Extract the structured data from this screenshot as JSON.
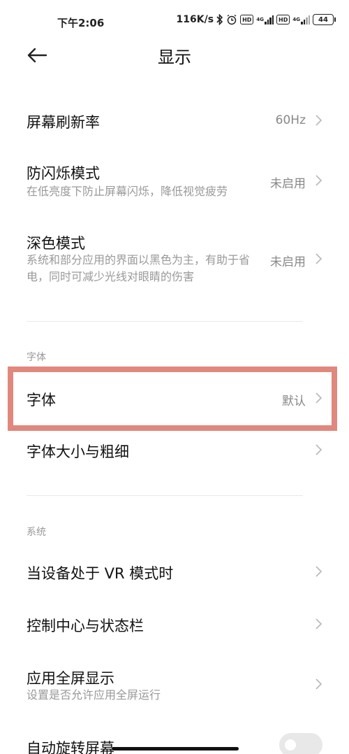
{
  "status_bar": {
    "time": "下午2:06",
    "speed": "116K/s",
    "hd1": "HD",
    "net1": "4G",
    "hd2": "HD",
    "net2": "4G",
    "battery": "44"
  },
  "header": {
    "title": "显示"
  },
  "rows": {
    "refresh": {
      "title": "屏幕刷新率",
      "value": "60Hz"
    },
    "flicker": {
      "title": "防闪烁模式",
      "sub": "在低亮度下防止屏幕闪烁，降低视觉疲劳",
      "value": "未启用"
    },
    "dark": {
      "title": "深色模式",
      "sub": "系统和部分应用的界面以黑色为主，有助于省电，同时可减少光线对眼睛的伤害",
      "value": "未启用"
    },
    "font": {
      "title": "字体",
      "value": "默认"
    },
    "font_size": {
      "title": "字体大小与粗细"
    },
    "vr": {
      "title": "当设备处于 VR 模式时"
    },
    "control": {
      "title": "控制中心与状态栏"
    },
    "fullscreen": {
      "title": "应用全屏显示",
      "sub": "设置是否允许应用全屏运行"
    },
    "rotate": {
      "title": "自动旋转屏幕",
      "enabled": false
    }
  },
  "sections": {
    "font": "字体",
    "system": "系统"
  },
  "colors": {
    "highlight_border": "#e0887d",
    "subtitle": "#999999"
  }
}
